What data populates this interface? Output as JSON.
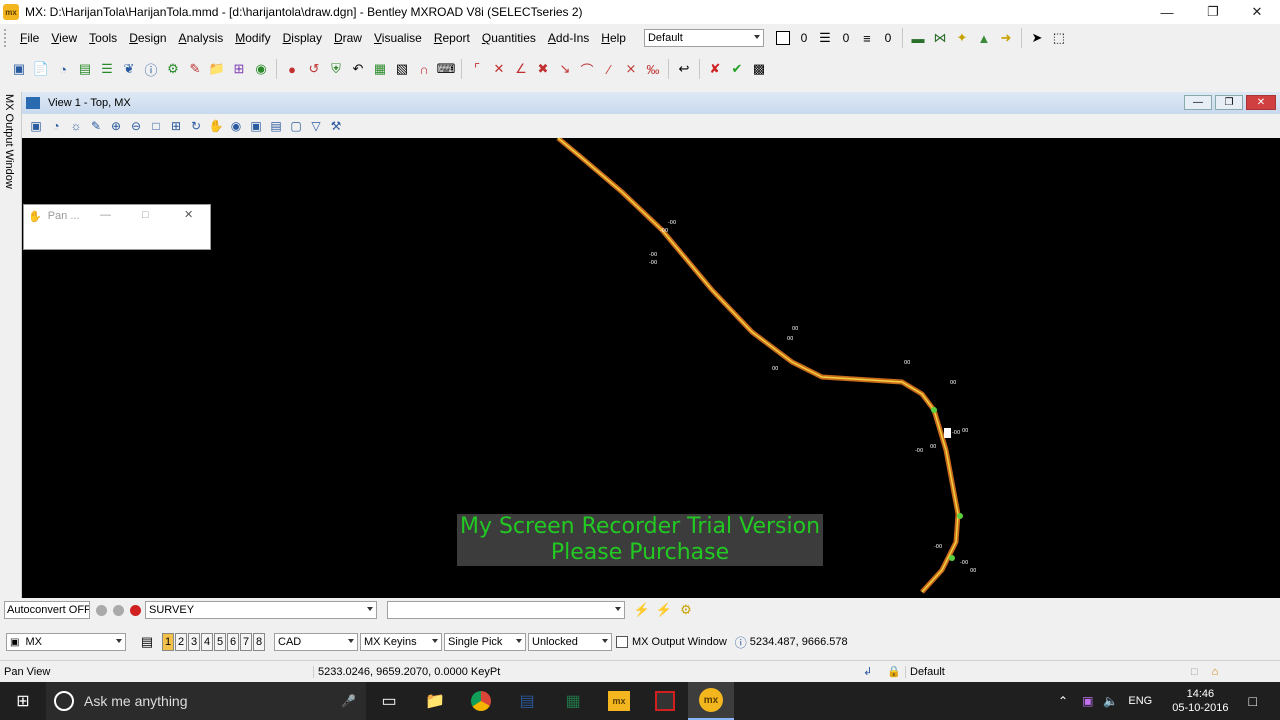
{
  "window": {
    "title": "MX: D:\\HarijanTola\\HarijanTola.mmd - [d:\\harijantola\\draw.dgn] - Bentley MXROAD V8i (SELECTseries 2)",
    "app_icon": "mx"
  },
  "menu": [
    "File",
    "View",
    "Tools",
    "Design",
    "Analysis",
    "Modify",
    "Display",
    "Draw",
    "Visualise",
    "Report",
    "Quantities",
    "Add-Ins",
    "Help"
  ],
  "toolbar": {
    "level_value": "Default",
    "color_value": "0",
    "style_value": "0",
    "weight_value": "0"
  },
  "view": {
    "title": "View 1 - Top, MX"
  },
  "side_panel": {
    "label": "MX Output Window"
  },
  "pan_dialog": {
    "title": "Pan ..."
  },
  "watermark": {
    "line1": "My Screen Recorder Trial Version",
    "line2": "Please Purchase"
  },
  "keyin_bar": {
    "autoconvert": "Autoconvert OFF",
    "survey_value": "SURVEY",
    "second_value": ""
  },
  "mode_bar": {
    "mx_value": "MX",
    "view_numbers": [
      "1",
      "2",
      "3",
      "4",
      "5",
      "6",
      "7",
      "8"
    ],
    "cad_value": "CAD",
    "keyins_value": "MX Keyins",
    "pick_value": "Single Pick",
    "lock_value": "Unlocked",
    "output_window_label": "MX Output Window",
    "coords": "5234.487, 9666.578"
  },
  "status": {
    "left": "Pan View",
    "coords": "5233.0246, 9659.2070, 0.0000 KeyPt",
    "level": "Default"
  },
  "taskbar": {
    "search_placeholder": "Ask me anything",
    "lang": "ENG",
    "time": "14:46",
    "date": "05-10-2016"
  }
}
